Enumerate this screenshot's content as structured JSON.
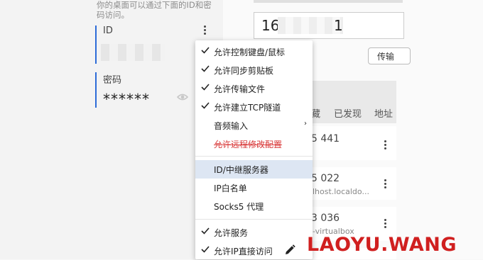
{
  "left": {
    "description": "你的桌面可以通过下面的ID和密码访问。",
    "id_label": "ID",
    "password_label": "密码",
    "password_value": "******"
  },
  "right": {
    "id_value_prefix": "16",
    "id_value_suffix": "1",
    "transfer_button": "传输",
    "tabs": [
      "藏",
      "已发现",
      "地址"
    ],
    "cards": [
      {
        "num": "5 441",
        "host": ""
      },
      {
        "num": "5 022",
        "host": "lhost.localdo..."
      },
      {
        "num": "3 036",
        "host": "-virtualbox"
      },
      {
        "num": "",
        "host": ""
      }
    ]
  },
  "menu": {
    "items": [
      {
        "label": "允许控制键盘/鼠标",
        "checked": true
      },
      {
        "label": "允许同步剪贴板",
        "checked": true
      },
      {
        "label": "允许传输文件",
        "checked": true
      },
      {
        "label": "允许建立TCP隧道",
        "checked": true
      },
      {
        "label": "音频输入",
        "checked": false,
        "submenu": true
      },
      {
        "label": "允许远程修改配置",
        "checked": false,
        "strike": true
      },
      {
        "label": "ID/中继服务器",
        "checked": false,
        "highlighted": true
      },
      {
        "label": "IP白名单",
        "checked": false
      },
      {
        "label": "Socks5 代理",
        "checked": false
      },
      {
        "label": "允许服务",
        "checked": true
      },
      {
        "label": "允许IP直接访问",
        "checked": true
      }
    ],
    "submenu_arrow": "›"
  },
  "watermark": "LAOYU.WANG",
  "colors": {
    "accent": "#2d6cd8",
    "watermark": "#d01f1f",
    "highlight": "#dde6f3"
  }
}
